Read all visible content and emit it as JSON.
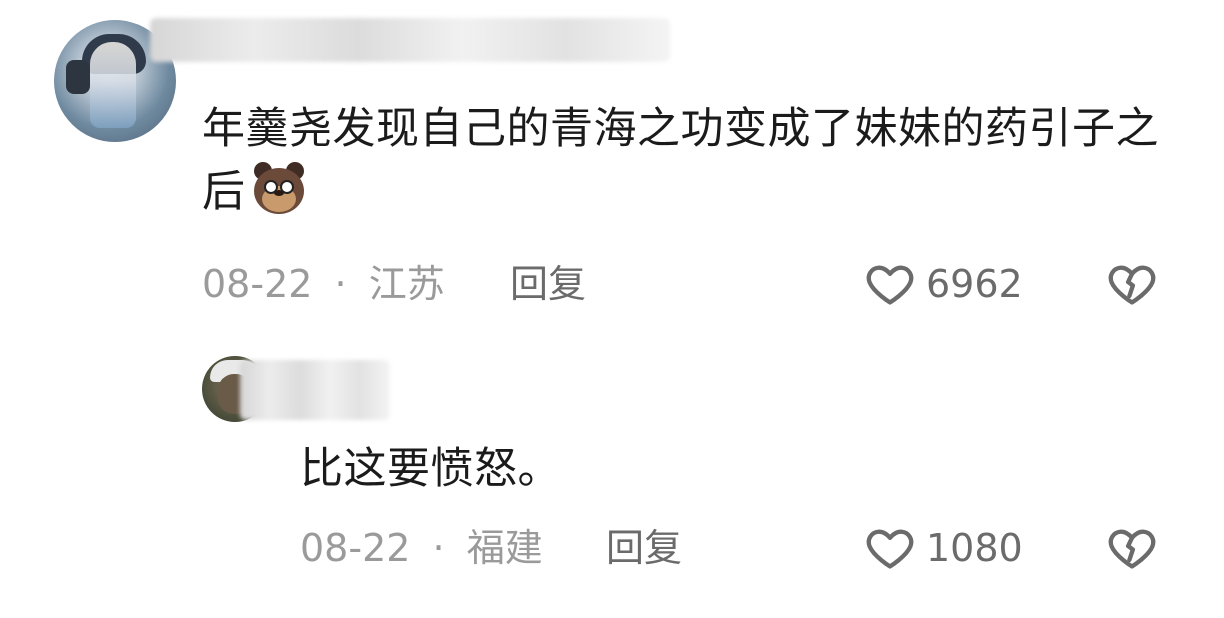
{
  "comments": [
    {
      "text": "年羹尧发现自己的青海之功变成了妹妹的药引子之后",
      "date": "08-22",
      "separator": "·",
      "location": "江苏",
      "reply_label": "回复",
      "likes": "6962"
    },
    {
      "text": "比这要愤怒。",
      "date": "08-22",
      "separator": "·",
      "location": "福建",
      "reply_label": "回复",
      "likes": "1080"
    }
  ],
  "icons": {
    "like": "heart-outline-icon",
    "dislike": "broken-heart-icon",
    "emoji": "bear-face-emoji"
  },
  "colors": {
    "text": "#1b1b1b",
    "meta": "#9a9a9a",
    "action": "#6b6b6b"
  }
}
